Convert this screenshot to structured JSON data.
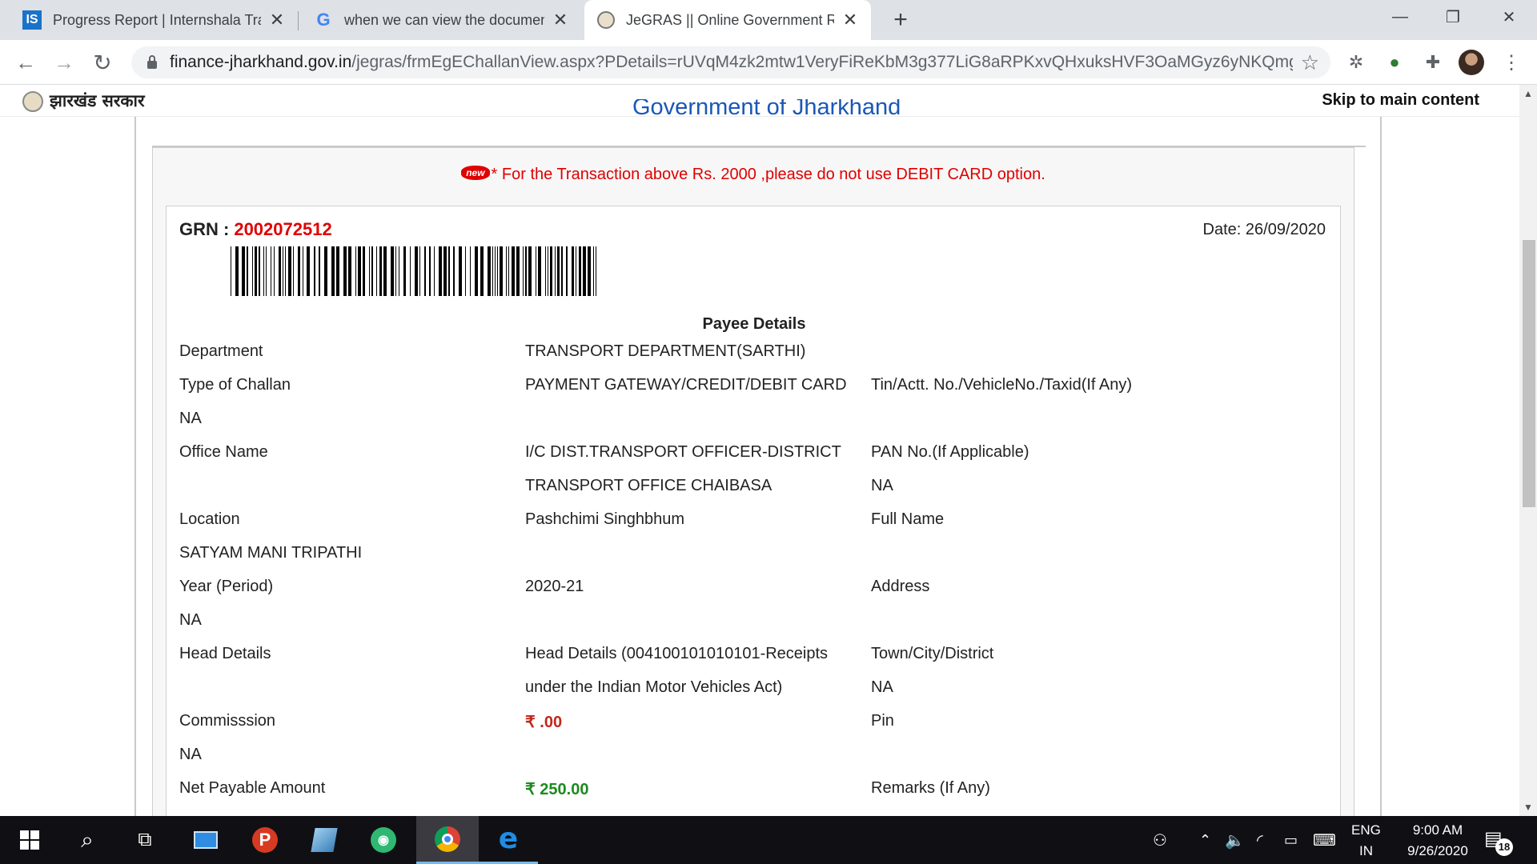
{
  "browser": {
    "tabs": [
      {
        "title": "Progress Report | Internshala Trai",
        "favicon": "internshala-logo-icon",
        "favicon_text": "IS"
      },
      {
        "title": "when we can view the document",
        "favicon": "google-g-icon",
        "favicon_text": "G"
      },
      {
        "title": "JeGRAS || Online Government Re",
        "favicon": "jharkhand-seal-icon",
        "active": true
      }
    ],
    "url_host": "finance-jharkhand.gov.in",
    "url_path": "/jegras/frmEgEChallanView.aspx?PDetails=rUVqM4zk2mtw1VeryFiReKbM3g377LiG8aRPKxvQHxuksHVF3OaMGyz6yNKQmg..."
  },
  "page": {
    "gov_name": "झारखंड सरकार",
    "skip_link": "Skip to main content",
    "clipped_heading": "Government of Jharkhand",
    "notice_badge": "new",
    "notice": "* For the Transaction above Rs. 2000 ,please do not use DEBIT CARD option.",
    "grn_label": "GRN  :",
    "grn_value": "2002072512",
    "date": "Date: 26/09/2020",
    "section_title": "Payee Details",
    "details": {
      "department_label": "Department",
      "department_value": "TRANSPORT DEPARTMENT(SARTHI)",
      "challan_label": "Type of Challan",
      "challan_value": "PAYMENT GATEWAY/CREDIT/DEBIT CARD",
      "tin_label": "Tin/Actt. No./VehicleNo./Taxid(If Any)",
      "tin_value": "NA",
      "office_label": "Office Name",
      "office_value_1": "I/C DIST.TRANSPORT OFFICER-DISTRICT",
      "office_value_2": "TRANSPORT OFFICE CHAIBASA",
      "pan_label": "PAN No.(If Applicable)",
      "pan_value": "NA",
      "location_label": "Location",
      "location_value": "Pashchimi Singhbhum",
      "fullname_label": "Full Name",
      "fullname_value": "SATYAM MANI TRIPATHI",
      "year_label": "Year (Period)",
      "year_value": "2020-21",
      "address_label": "Address",
      "address_value": "NA",
      "head_label": "Head Details",
      "head_value_1": "Head Details (004100101010101-Receipts",
      "head_value_2": "under the Indian Motor Vehicles Act)",
      "town_label": "Town/City/District",
      "town_value": "NA",
      "commission_label": "Commisssion",
      "commission_value": "₹ .00",
      "pin_label": "Pin",
      "pin_value": "NA",
      "net_label": "Net Payable Amount",
      "net_value": "₹ 250.00",
      "remarks_label": "Remarks (If Any)"
    }
  },
  "taskbar": {
    "language": "ENG",
    "region": "IN",
    "time": "9:00 AM",
    "date": "9/26/2020",
    "notification_count": "18"
  },
  "colors": {
    "notice_red": "#e00000",
    "commission_red": "#c0281c",
    "amount_green": "#1d8a20",
    "heading_blue": "#1a57b7"
  }
}
